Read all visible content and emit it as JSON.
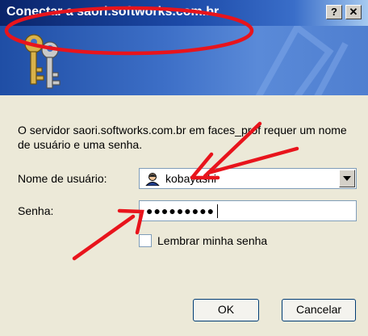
{
  "window": {
    "title": "Conectar a saori.softworks.com.br",
    "help_label": "?",
    "close_label": "✕"
  },
  "banner": {
    "icon": "keys-icon"
  },
  "message": "O servidor saori.softworks.com.br em faces_prof requer um nome de usuário e uma senha.",
  "form": {
    "username_label": "Nome de usuário:",
    "username_value": "kobayashi",
    "password_label": "Senha:",
    "password_value": "●●●●●●●●●",
    "remember_label": "Lembrar minha senha",
    "remember_checked": false
  },
  "buttons": {
    "ok": "OK",
    "cancel": "Cancelar"
  },
  "annotations": {
    "color": "#e8141c"
  }
}
